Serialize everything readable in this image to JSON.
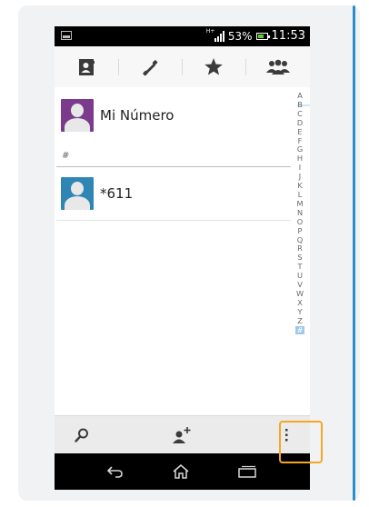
{
  "status_bar": {
    "network_type": "H+",
    "battery_percent": "53%",
    "time": "11:53"
  },
  "tabs": [
    {
      "id": "contacts",
      "icon": "contacts-card-icon",
      "active": true
    },
    {
      "id": "phone",
      "icon": "phone-icon",
      "active": false
    },
    {
      "id": "favorites",
      "icon": "star-icon",
      "active": false
    },
    {
      "id": "groups",
      "icon": "groups-icon",
      "active": false
    }
  ],
  "contacts": {
    "me": {
      "name": "Mi Número",
      "avatar_color": "#7b3a8c"
    },
    "section_label": "#",
    "items": [
      {
        "name": "*611",
        "avatar_color": "#2f86b5"
      }
    ]
  },
  "alphabet_index": [
    "A",
    "B",
    "C",
    "D",
    "E",
    "F",
    "G",
    "H",
    "I",
    "J",
    "K",
    "L",
    "M",
    "N",
    "O",
    "P",
    "Q",
    "R",
    "S",
    "T",
    "U",
    "V",
    "W",
    "X",
    "Y",
    "Z",
    "#"
  ],
  "alphabet_active": "#",
  "action_bar": {
    "search_icon": "search-icon",
    "add_contact_icon": "add-contact-icon",
    "menu_icon": "overflow-menu-icon"
  },
  "nav_bar": {
    "back_icon": "back-icon",
    "home_icon": "home-icon",
    "recents_icon": "recent-apps-icon"
  },
  "colors": {
    "accent": "#3aa3d9",
    "highlight_box": "#f5a623",
    "frame_edge": "#2a8fc8"
  }
}
